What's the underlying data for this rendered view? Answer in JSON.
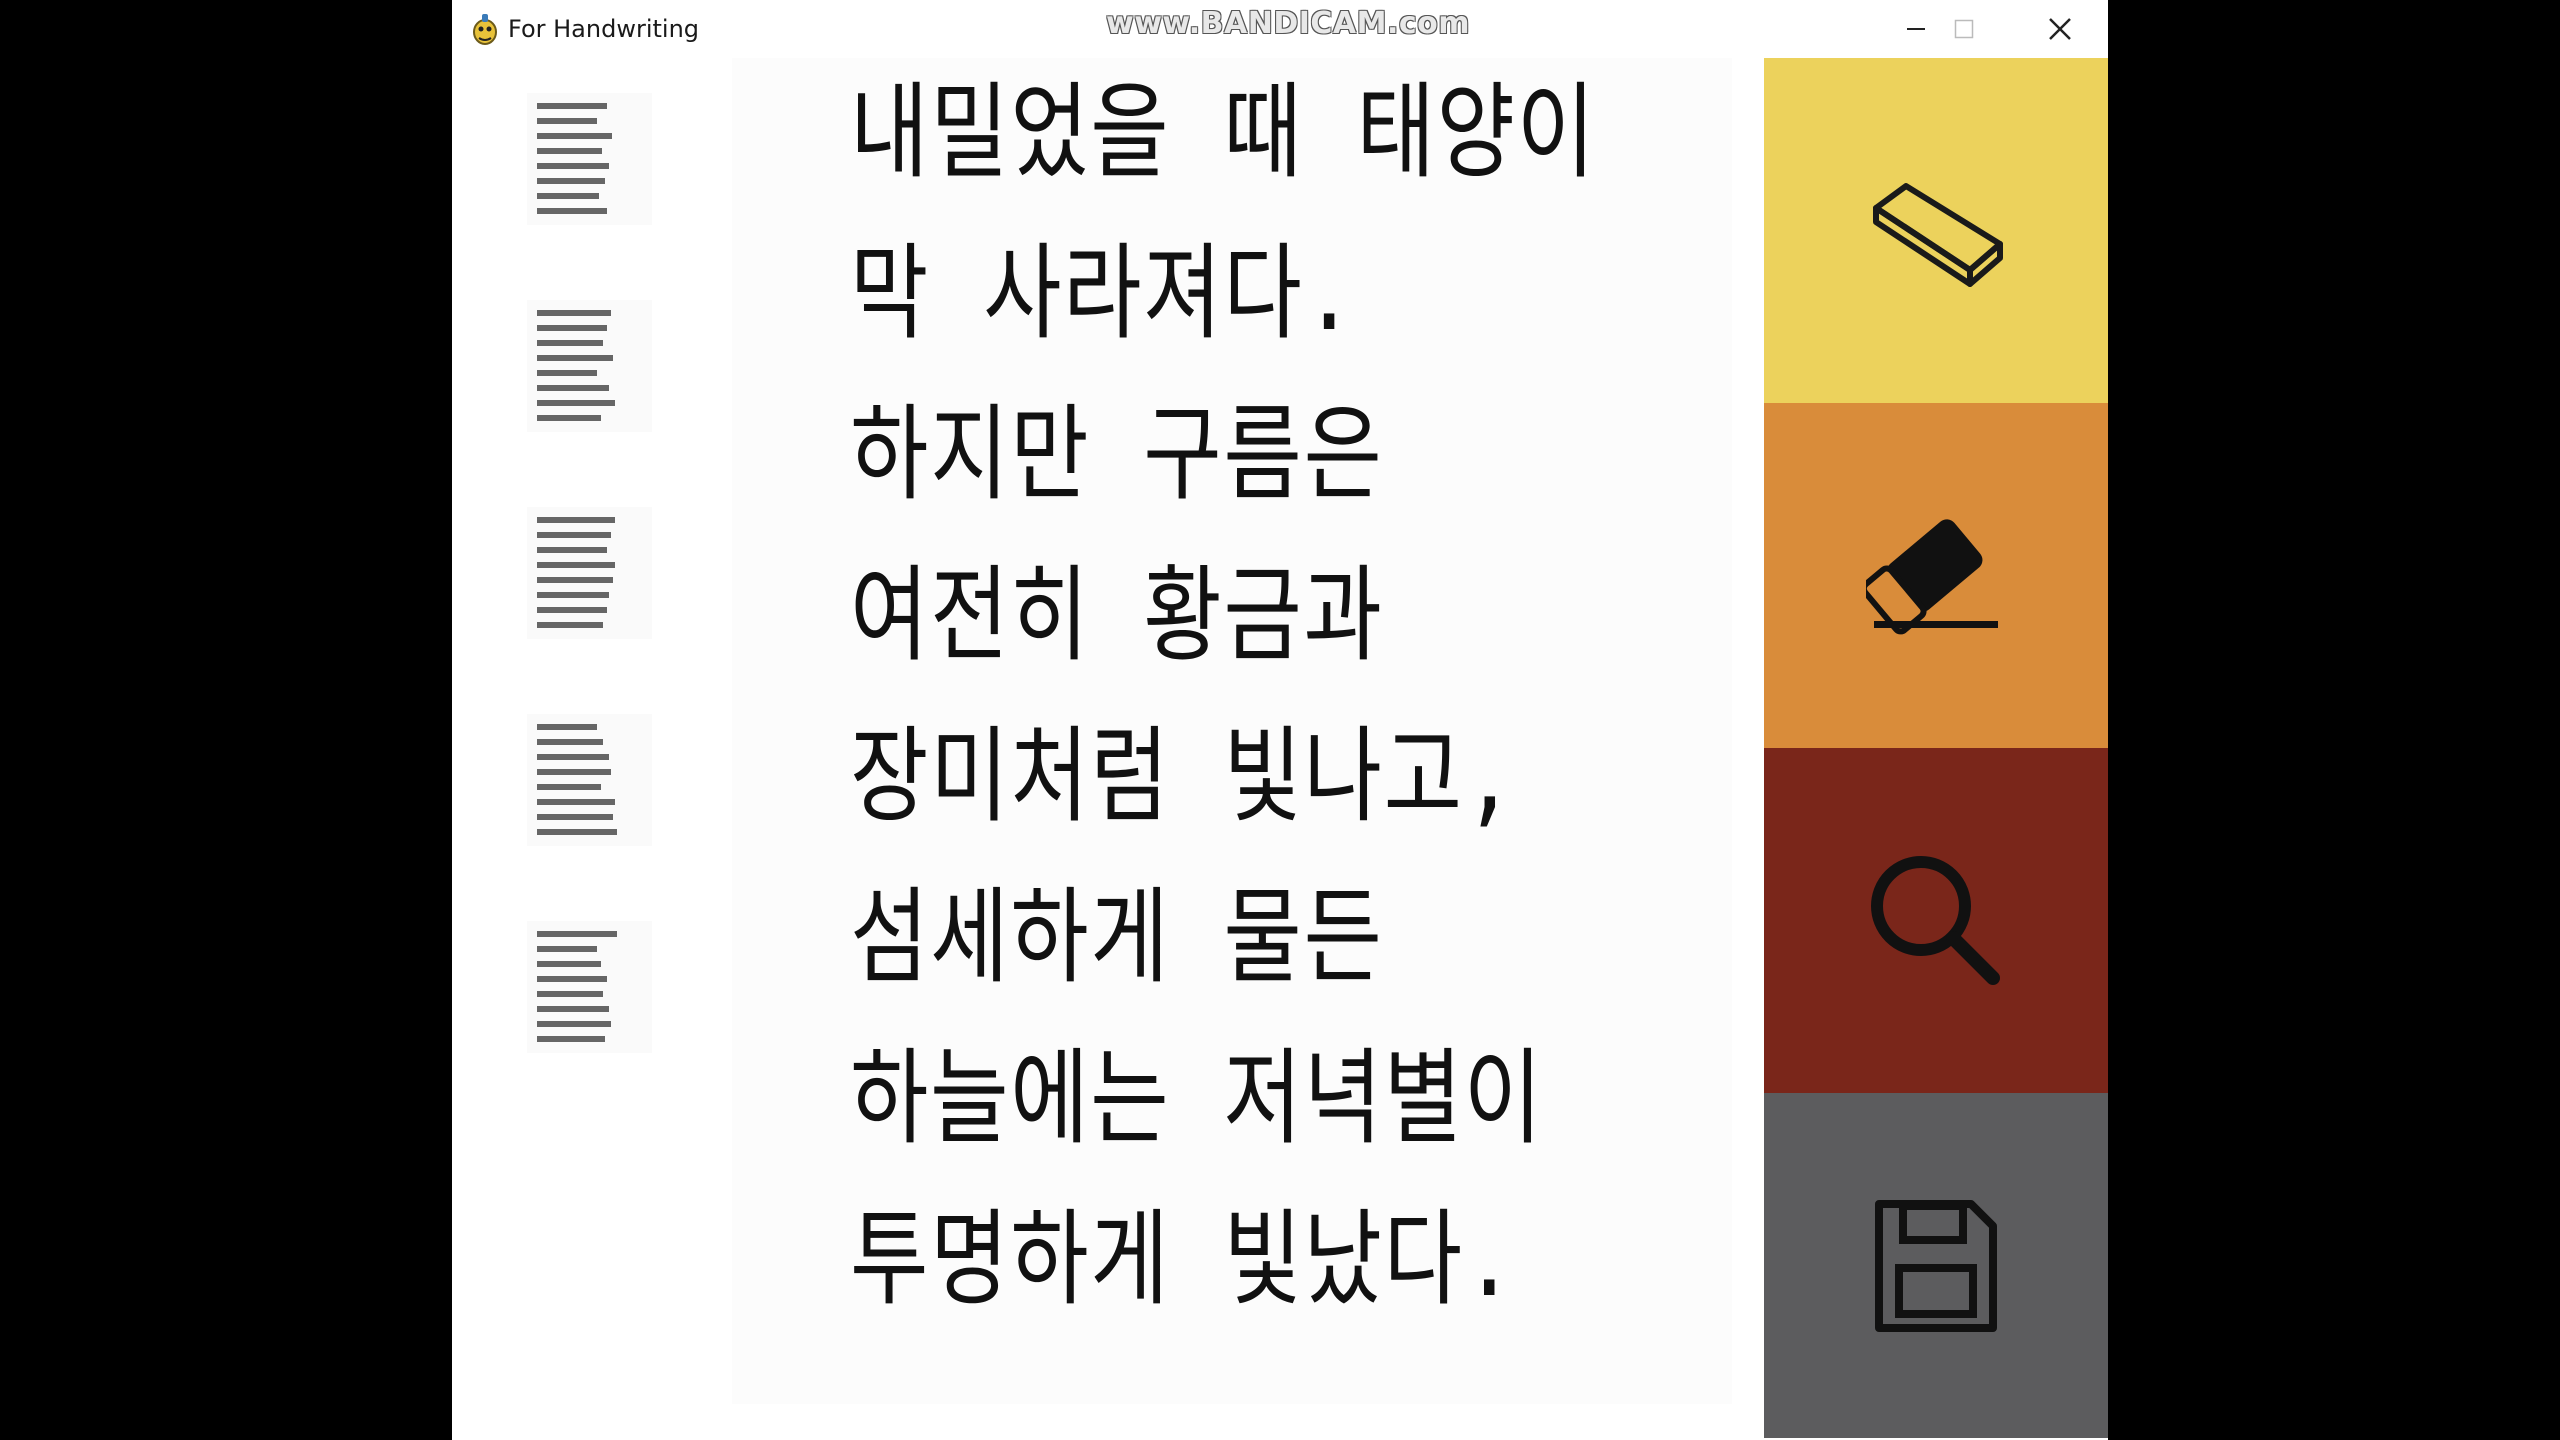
{
  "window": {
    "title": "For Handwriting",
    "watermark": "www.BANDICAM.com",
    "controls": {
      "minimize_icon": "minimize-icon",
      "maximize_icon": "maximize-icon",
      "close_icon": "close-icon"
    }
  },
  "pages": [
    {
      "name": "page-1"
    },
    {
      "name": "page-2"
    },
    {
      "name": "page-3"
    },
    {
      "name": "page-4"
    },
    {
      "name": "page-5"
    }
  ],
  "canvas": {
    "lines": [
      "내밀었을 때 태양이",
      "막 사라져다.",
      "하지만 구름은",
      "여전히 황금과",
      "장미처럼 빛나고,",
      "섬세하게 물든",
      "하늘에는 저녁별이",
      "투명하게 빛났다."
    ]
  },
  "tools": [
    {
      "name": "eraser-tool",
      "icon": "eraser-outline-icon",
      "color": "#ecd25c"
    },
    {
      "name": "erase-all-tool",
      "icon": "eraser-filled-icon",
      "color": "#d98c3a"
    },
    {
      "name": "search-tool",
      "icon": "search-icon",
      "color": "#7a261a"
    },
    {
      "name": "save-tool",
      "icon": "save-icon",
      "color": "#5c5c5e"
    }
  ]
}
